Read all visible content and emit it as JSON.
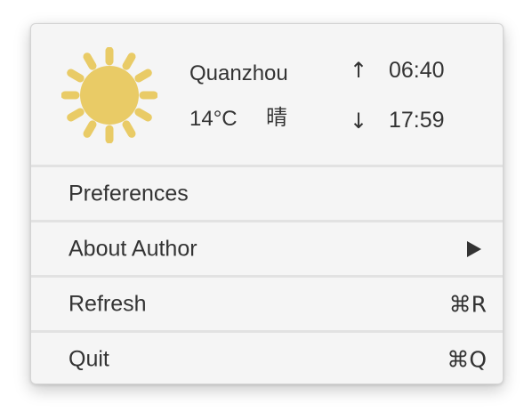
{
  "weather": {
    "city": "Quanzhou",
    "temperature": "14°C",
    "condition": "晴",
    "sunrise_arrow": "↑",
    "sunset_arrow": "↓",
    "sunrise": "06:40",
    "sunset": "17:59",
    "icon": "sun-icon",
    "icon_color": "#e9cb66"
  },
  "menu": {
    "items": [
      {
        "label": "Preferences",
        "shortcut": ""
      },
      {
        "label": "About Author",
        "submenu_icon": "triangle-right-icon"
      },
      {
        "label": "Refresh",
        "shortcut": "⌘R"
      },
      {
        "label": "Quit",
        "shortcut": "⌘Q"
      }
    ]
  }
}
